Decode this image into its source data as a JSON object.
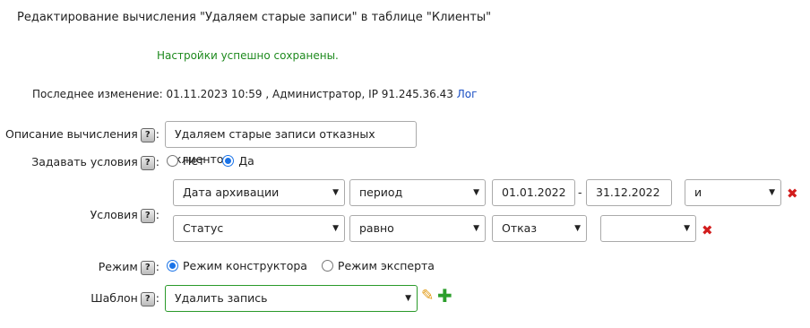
{
  "page": {
    "title": "Редактирование вычисления \"Удаляем старые записи\" в таблице \"Клиенты\"",
    "success_message": "Настройки успешно сохранены.",
    "last_modified_text": "Последнее изменение: 01.11.2023 10:59 , Администратор, IP 91.245.36.43",
    "log_link": "Лог"
  },
  "form": {
    "description": {
      "label": "Описание вычисления",
      "value": "Удаляем старые записи отказных клиенто"
    },
    "set_conditions": {
      "label": "Задавать условия",
      "option_no": "Нет",
      "option_yes": "Да",
      "selected": "Да"
    },
    "conditions": {
      "label": "Условия",
      "row1": {
        "field": "Дата архивации",
        "operator": "период",
        "from": "01.01.2022",
        "dash": "-",
        "to": "31.12.2022",
        "logic": "и"
      },
      "row2": {
        "field": "Статус",
        "operator": "равно",
        "value": "Отказ",
        "logic": ""
      }
    },
    "mode": {
      "label": "Режим",
      "option_constructor": "Режим конструктора",
      "option_expert": "Режим эксперта",
      "selected": "Режим конструктора"
    },
    "template": {
      "label": "Шаблон",
      "value": "Удалить запись"
    }
  },
  "icons": {
    "help": "?",
    "delete": "✖",
    "edit": "✎",
    "add": "✚"
  },
  "colors": {
    "success": "#1e8a1e",
    "link": "#1a4fc4",
    "delete": "#d21d1d",
    "add": "#2c9e2c",
    "radio_active": "#1a73e8"
  }
}
